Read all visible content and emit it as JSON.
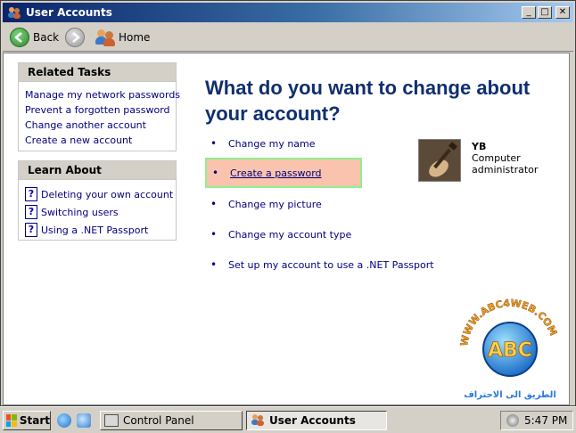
{
  "window": {
    "title": "User Accounts",
    "buttons": {
      "minimize": "_",
      "maximize": "□",
      "close": "✕"
    }
  },
  "toolbar": {
    "back_label": "Back",
    "home_label": "Home"
  },
  "related_tasks": {
    "title": "Related Tasks",
    "items": [
      "Manage my network passwords",
      "Prevent a forgotten password",
      "Change another account",
      "Create a new account"
    ]
  },
  "learn_about": {
    "title": "Learn About",
    "items": [
      "Deleting your own account",
      "Switching users",
      "Using a .NET Passport"
    ]
  },
  "main": {
    "heading_line1": "What do you want to change about",
    "heading_line2": "your account?",
    "options": [
      "Change my name",
      "Create a password",
      "Change my picture",
      "Change my account type",
      "Set up my account to use a .NET Passport"
    ],
    "highlighted_option_index": 1,
    "highlight_color": "#f9c3ad"
  },
  "account": {
    "name": "YB",
    "role": "Computer administrator"
  },
  "watermark": {
    "site": "WWW.ABC4WEB.COM",
    "letters": "ABC",
    "tagline": "الطريق الى الاحتراف"
  },
  "taskbar": {
    "start_label": "Start",
    "tasks": [
      "Control Panel",
      "User Accounts"
    ],
    "clock": "5:47 PM"
  }
}
